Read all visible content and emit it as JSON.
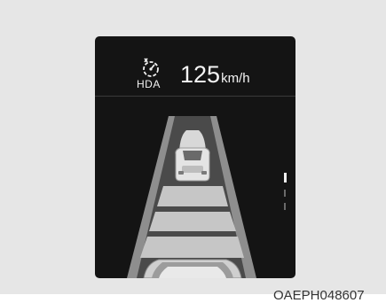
{
  "header": {
    "hda_label": "HDA",
    "speed_value": "125",
    "speed_unit": "km/h"
  },
  "icons": {
    "hda": "steering-speed-assist-icon",
    "lead_vehicle": "lead-car-icon",
    "own_vehicle": "own-car-icon",
    "lane_marker": "lane-indicator-icon"
  },
  "caption": "OAEPH048607",
  "colors": {
    "panel": "#141414",
    "road": "#4a4a4a",
    "distance_bar": "#c8c8c8",
    "road_edge": "#9a9a9a"
  }
}
